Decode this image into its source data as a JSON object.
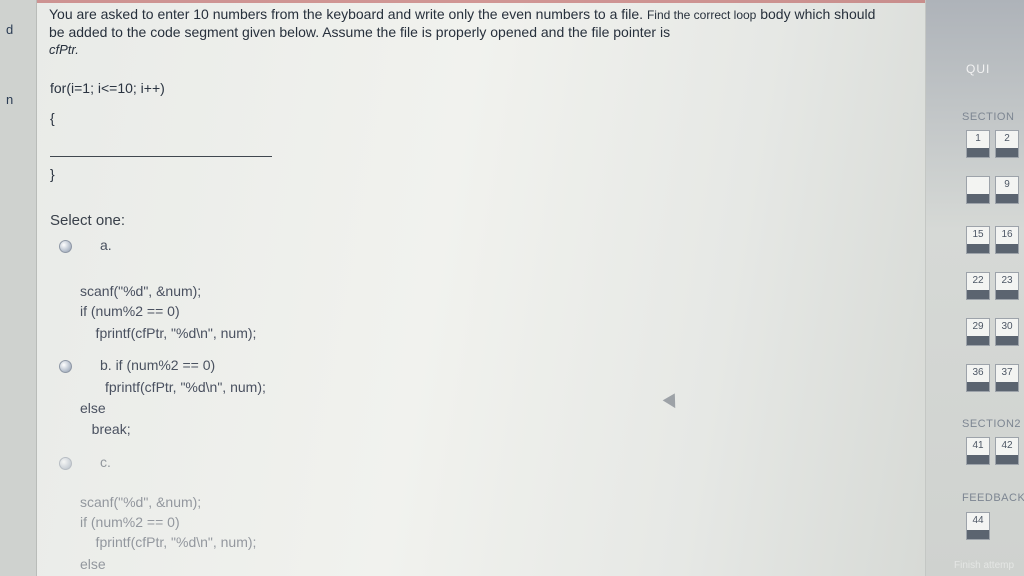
{
  "left_strip": {
    "marks": [
      "d",
      "n"
    ]
  },
  "question": {
    "text_part1": "You are asked to enter 10 numbers from the keyboard and write only the even numbers to a file. ",
    "text_part2": "Find the correct loop",
    "text_part3": "body which should be added to the code segment given below. Assume the file is properly opened and the file pointer is",
    "pointer_name": "cfPtr.",
    "code_for": "for(i=1; i<=10; i++)",
    "code_open": "{",
    "code_close": "}"
  },
  "select_one": "Select one:",
  "options": [
    {
      "label": "a.",
      "code": [
        "scanf(\"%d\", &num);",
        "if (num%2 == 0)",
        "    fprintf(cfPtr, \"%d\\n\", num);"
      ]
    },
    {
      "label": "b. if (num%2 == 0)",
      "code": [
        "fprintf(cfPtr, \"%d\\n\", num);",
        "else",
        "   break;"
      ]
    },
    {
      "label": "c.",
      "code": [
        "scanf(\"%d\", &num);",
        "if (num%2 == 0)",
        "    fprintf(cfPtr, \"%d\\n\", num);",
        "else"
      ]
    }
  ],
  "quiz_nav": {
    "title": "QUI",
    "section1_label": "SECTION",
    "section2_label": "SECTION2",
    "feedback_label": "FEEDBACK",
    "finish_label": "Finish attemp",
    "questions": [
      "1",
      "2",
      "",
      "9",
      "15",
      "16",
      "22",
      "23",
      "29",
      "30",
      "36",
      "37",
      "41",
      "42",
      "44"
    ]
  }
}
